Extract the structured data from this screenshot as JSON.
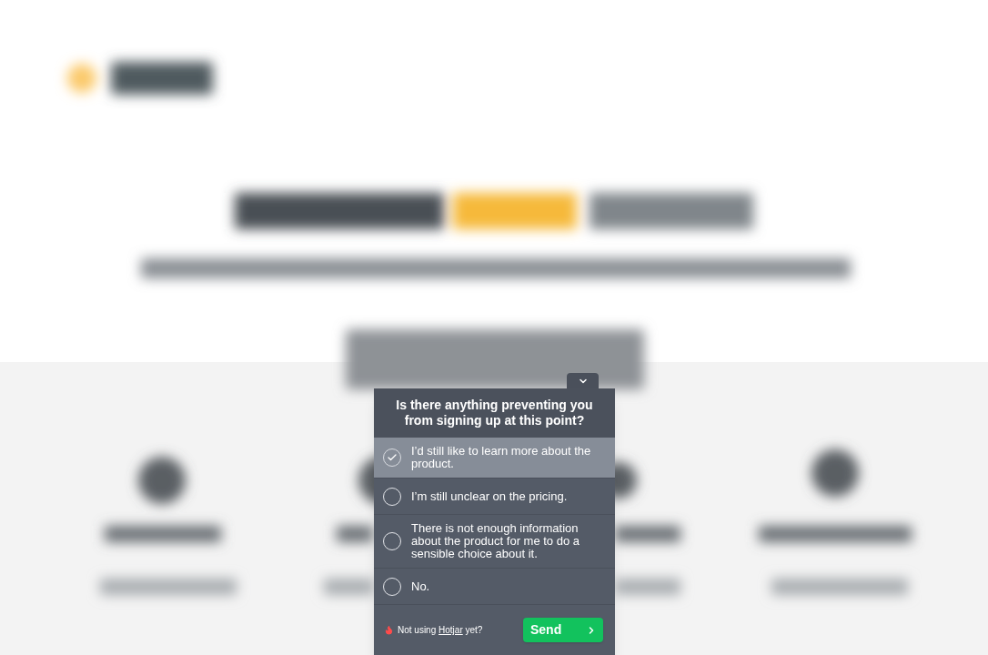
{
  "survey": {
    "question": "Is there anything preventing you from signing up at this point?",
    "options": [
      {
        "label": "I’d still like to learn more about the product.",
        "selected": true
      },
      {
        "label": "I’m still unclear on the pricing.",
        "selected": false
      },
      {
        "label": "There is not enough information about the product for me to do a sensible choice about it.",
        "selected": false
      },
      {
        "label": "No.",
        "selected": false
      }
    ],
    "footer": {
      "before": "Not using",
      "link": "Hotjar",
      "after": "yet?"
    },
    "send": "Send"
  }
}
